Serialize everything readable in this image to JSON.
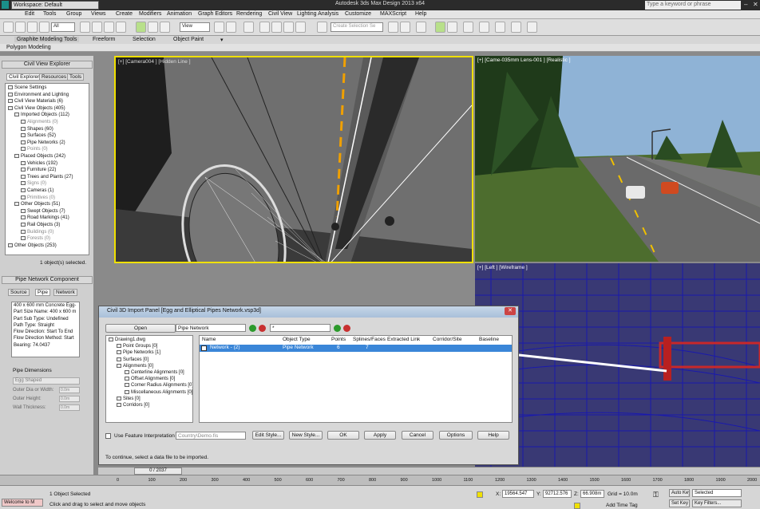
{
  "app": {
    "title": "Autodesk 3ds Max Design 2013 x64",
    "workspace": "Workspace: Default",
    "search_placeholder": "Type a keyword or phrase"
  },
  "menu": [
    "Edit",
    "Tools",
    "Group",
    "Views",
    "Create",
    "Modifiers",
    "Animation",
    "Graph Editors",
    "Rendering",
    "Civil View",
    "Lighting Analysis",
    "Customize",
    "MAXScript",
    "Help"
  ],
  "toolbar": {
    "selection_filter": "All",
    "view_select": "View",
    "named_selection": "Create Selection Se"
  },
  "ribbon": {
    "tabs": [
      "Graphite Modeling Tools",
      "Freeform",
      "Selection",
      "Object Paint"
    ],
    "sub": "Polygon Modeling"
  },
  "civil_explorer": {
    "title": "Civil View Explorer",
    "tabs": [
      "Civil Explorer",
      "Resources",
      "Tools"
    ],
    "tree": [
      {
        "label": "Scene Settings",
        "level": 0,
        "dim": false
      },
      {
        "label": "Environment and Lighting",
        "level": 0,
        "dim": false
      },
      {
        "label": "Civil View Materials (6)",
        "level": 0,
        "dim": false
      },
      {
        "label": "Civil View Objects (405)",
        "level": 0,
        "dim": false
      },
      {
        "label": "Imported Objects (112)",
        "level": 1,
        "dim": false
      },
      {
        "label": "Alignments (0)",
        "level": 2,
        "dim": true
      },
      {
        "label": "Shapes (60)",
        "level": 2,
        "dim": false
      },
      {
        "label": "Surfaces (52)",
        "level": 2,
        "dim": false
      },
      {
        "label": "Pipe Networks (2)",
        "level": 2,
        "dim": false
      },
      {
        "label": "Points (0)",
        "level": 2,
        "dim": true
      },
      {
        "label": "Placed Objects (242)",
        "level": 1,
        "dim": false
      },
      {
        "label": "Vehicles (192)",
        "level": 2,
        "dim": false
      },
      {
        "label": "Furniture (22)",
        "level": 2,
        "dim": false
      },
      {
        "label": "Trees and Plants (27)",
        "level": 2,
        "dim": false
      },
      {
        "label": "Signs (0)",
        "level": 2,
        "dim": true
      },
      {
        "label": "Cameras (1)",
        "level": 2,
        "dim": false
      },
      {
        "label": "Primitives (0)",
        "level": 2,
        "dim": true
      },
      {
        "label": "Other Objects (51)",
        "level": 1,
        "dim": false
      },
      {
        "label": "Swept Objects (7)",
        "level": 2,
        "dim": false
      },
      {
        "label": "Road Markings (41)",
        "level": 2,
        "dim": false
      },
      {
        "label": "Rail Objects (3)",
        "level": 2,
        "dim": false
      },
      {
        "label": "Buildings (0)",
        "level": 2,
        "dim": true
      },
      {
        "label": "Forests (0)",
        "level": 2,
        "dim": true
      },
      {
        "label": "Other Objects (253)",
        "level": 0,
        "dim": false
      }
    ],
    "selection_status": "1 object(s) selected."
  },
  "pipe_component": {
    "title": "Pipe Network Component",
    "tabs": [
      "Source",
      "Pipe",
      "Network"
    ],
    "info": [
      "400 x 600 mm Concrete Egg-",
      "Part Size Name: 400 x 600 m",
      "Part Sub Type: Undefined",
      "Path Type: Straight",
      "Flow Direction: Start To End",
      "Flow Direction Method: Start",
      "Bearing: 74.0437"
    ],
    "dimensions_title": "Pipe Dimensions",
    "shape": "Egg Shaped",
    "fields": [
      "Outer Dia or Width:",
      "Outer Height:",
      "Wall Thickness:"
    ],
    "field_values": [
      "0.0m",
      "0.0m",
      "0.0m"
    ]
  },
  "viewports": {
    "v1": "[+] [Camera004 ] [Hidden Line ]",
    "v2": "[+] [Came-035mm Lens-001 ] [Realistic ]",
    "v3": "[+] [Left ] [Wireframe ]"
  },
  "dialog": {
    "title": "Civil 3D Import Panel [Egg and Elliptical Pipes Network.vsp3d]",
    "open_label": "Open",
    "type_select": "Pipe Network",
    "filter_value": "*",
    "tree": [
      {
        "label": "Drawing1.dwg",
        "level": 0
      },
      {
        "label": "Point Groups [0]",
        "level": 1
      },
      {
        "label": "Pipe Networks [1]",
        "level": 1
      },
      {
        "label": "Surfaces [0]",
        "level": 1
      },
      {
        "label": "Alignments [0]",
        "level": 1
      },
      {
        "label": "Centerline Alignments [0]",
        "level": 2
      },
      {
        "label": "Offset Alignments [0]",
        "level": 2
      },
      {
        "label": "Corner Radius Alignments [0]",
        "level": 2
      },
      {
        "label": "Miscellaneous Alignments [0]",
        "level": 2
      },
      {
        "label": "Sites [0]",
        "level": 1
      },
      {
        "label": "Corridors [0]",
        "level": 1
      }
    ],
    "columns": [
      "Name",
      "Object Type",
      "Points",
      "Splines/Faces",
      "Extracted Link",
      "Corridor/Site",
      "Baseline"
    ],
    "rows": [
      {
        "name": "Network - (2)",
        "type": "Pipe Network",
        "points": "6",
        "splines": "7"
      }
    ],
    "feature_label": "Use Feature Interpretation",
    "feature_value": "Country\\Demo.fis",
    "buttons": [
      "Edit Style...",
      "New Style...",
      "OK",
      "Apply",
      "Cancel",
      "Options",
      "Help"
    ],
    "status": "To continue, select a data file to be imported."
  },
  "timeline": {
    "frame": "0 / 2037"
  },
  "trackbar_ticks": [
    "0",
    "100",
    "200",
    "300",
    "400",
    "500",
    "600",
    "700",
    "800",
    "900",
    "1000",
    "1100",
    "1200",
    "1300",
    "1400",
    "1500",
    "1600",
    "1700",
    "1800",
    "1900",
    "2000"
  ],
  "status": {
    "maxscript": "Welcome to M",
    "selected": "1 Object Selected",
    "prompt": "Click and drag to select and move objects",
    "x_label": "X:",
    "x": "19564.547",
    "y_label": "Y:",
    "y": "92712.576",
    "z_label": "Z:",
    "z": "66.908m",
    "grid": "Grid = 10.0m",
    "auto_key": "Auto Key",
    "set_key": "Set Key",
    "key_select": "Selected",
    "key_filters": "Key Filters...",
    "add_time_tag": "Add Time Tag"
  }
}
